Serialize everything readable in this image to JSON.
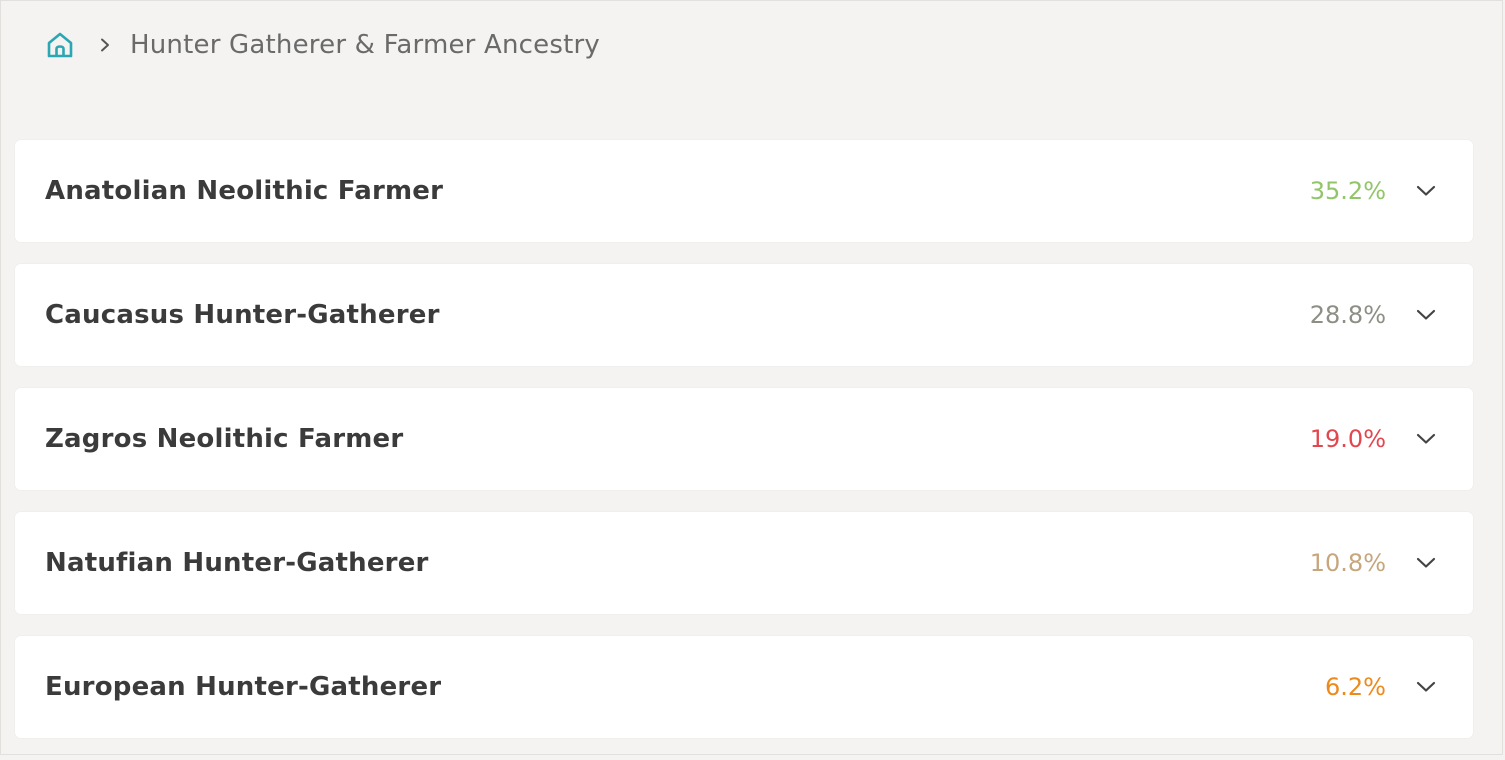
{
  "breadcrumb": {
    "home_icon": "home-icon",
    "separator_icon": "chevron-right-icon",
    "current": "Hunter Gatherer & Farmer Ancestry"
  },
  "colors": {
    "accent_teal": "#2aa7b3",
    "background": "#f4f3f1",
    "card": "#ffffff"
  },
  "ancestry": {
    "items": [
      {
        "name": "Anatolian Neolithic Farmer",
        "percent": "35.2%",
        "color": "#92c56a",
        "icon": "chevron-down-icon"
      },
      {
        "name": "Caucasus Hunter-Gatherer",
        "percent": "28.8%",
        "color": "#8e8e86",
        "icon": "chevron-down-icon"
      },
      {
        "name": "Zagros Neolithic Farmer",
        "percent": "19.0%",
        "color": "#e2474f",
        "icon": "chevron-down-icon"
      },
      {
        "name": "Natufian Hunter-Gatherer",
        "percent": "10.8%",
        "color": "#c6a67d",
        "icon": "chevron-down-icon"
      },
      {
        "name": "European Hunter-Gatherer",
        "percent": "6.2%",
        "color": "#ec8a1c",
        "icon": "chevron-down-icon"
      }
    ]
  }
}
